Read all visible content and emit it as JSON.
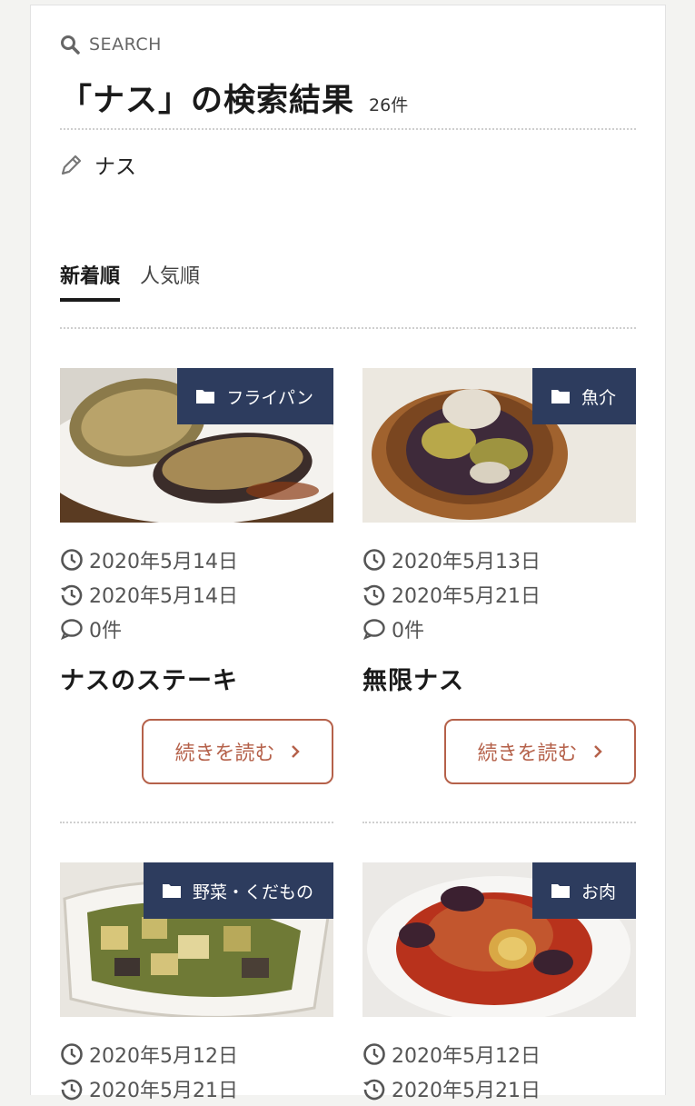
{
  "search": {
    "label": "SEARCH",
    "title": "「ナス」の検索結果",
    "count": "26件",
    "keyword": "ナス"
  },
  "tabs": [
    {
      "label": "新着順",
      "active": true
    },
    {
      "label": "人気順",
      "active": false
    }
  ],
  "more_label": "続きを読む",
  "accent_color": "#b5614a",
  "category_bg": "#2d3c5e",
  "cards": [
    {
      "category": "フライパン",
      "published": "2020年5月14日",
      "updated": "2020年5月14日",
      "comments": "0件",
      "title": "ナスのステーキ"
    },
    {
      "category": "魚介",
      "published": "2020年5月13日",
      "updated": "2020年5月21日",
      "comments": "0件",
      "title": "無限ナス"
    },
    {
      "category": "野菜・くだもの",
      "published": "2020年5月12日",
      "updated": "2020年5月21日"
    },
    {
      "category": "お肉",
      "published": "2020年5月12日",
      "updated": "2020年5月21日"
    }
  ]
}
